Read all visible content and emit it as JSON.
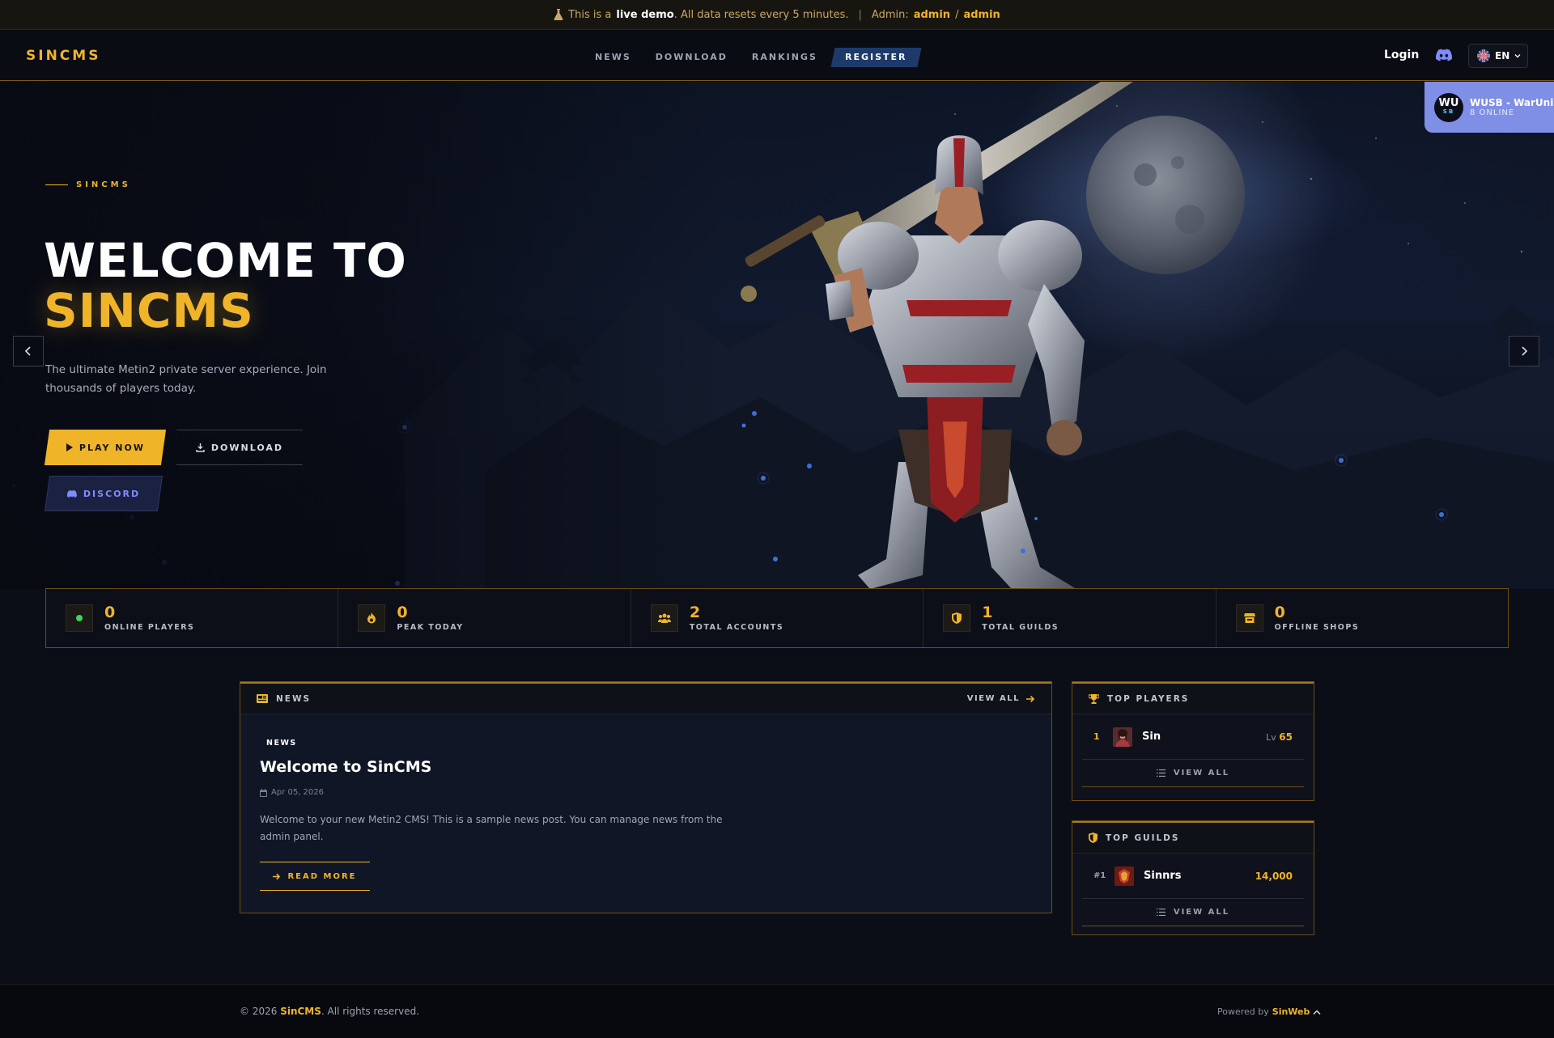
{
  "demo_banner": {
    "prefix": "This is a",
    "live_demo": "live demo",
    "reset_note": ". All data resets every 5 minutes.",
    "separator": "|",
    "admin_label": "Admin:",
    "admin_user": "admin",
    "admin_slash": "/",
    "admin_pass": "admin"
  },
  "nav": {
    "brand": "SINCMS",
    "links": [
      "NEWS",
      "DOWNLOAD",
      "RANKINGS"
    ],
    "register": "REGISTER",
    "login": "Login",
    "language": "EN"
  },
  "server_widget": {
    "logo_top": "WU",
    "logo_bottom": "SB",
    "name": "WUSB - WarUni",
    "online": "8 ONLINE"
  },
  "hero": {
    "kicker": "SINCMS",
    "title_line1": "WELCOME TO",
    "title_line2": "SINCMS",
    "subtitle": "The ultimate Metin2 private server experience. Join thousands of players today.",
    "play_button": "PLAY NOW",
    "download_button": "DOWNLOAD",
    "discord_button": "DISCORD"
  },
  "stats": [
    {
      "icon": "status-dot-icon",
      "value": "0",
      "label": "ONLINE PLAYERS"
    },
    {
      "icon": "fire-icon",
      "value": "0",
      "label": "PEAK TODAY"
    },
    {
      "icon": "users-icon",
      "value": "2",
      "label": "TOTAL ACCOUNTS"
    },
    {
      "icon": "shield-icon",
      "value": "1",
      "label": "TOTAL GUILDS"
    },
    {
      "icon": "store-icon",
      "value": "0",
      "label": "OFFLINE SHOPS"
    }
  ],
  "news": {
    "header": "NEWS",
    "view_all": "VIEW ALL",
    "post": {
      "tag": "NEWS",
      "title": "Welcome to SinCMS",
      "date": "Apr 05, 2026",
      "body": "Welcome to your new Metin2 CMS! This is a sample news post. You can manage news from the admin panel.",
      "read_more": "READ MORE"
    }
  },
  "top_players": {
    "header": "TOP PLAYERS",
    "rows": [
      {
        "rank": "1",
        "name": "Sin",
        "level_prefix": "Lv",
        "level": "65"
      }
    ],
    "view_all": "VIEW ALL"
  },
  "top_guilds": {
    "header": "TOP GUILDS",
    "rows": [
      {
        "rank": "#1",
        "name": "Sinnrs",
        "points": "14,000"
      }
    ],
    "view_all": "VIEW ALL"
  },
  "footer": {
    "copyright_prefix": "© 2026",
    "brand": "SinCMS",
    "copyright_suffix": ". All rights reserved.",
    "powered_prefix": "Powered by",
    "powered_brand": "SinWeb"
  },
  "colors": {
    "accent": "#f0b429",
    "background": "#0b0e16",
    "discord": "#7f8cff",
    "register": "#1d3a6b",
    "online": "#3fd45b"
  }
}
